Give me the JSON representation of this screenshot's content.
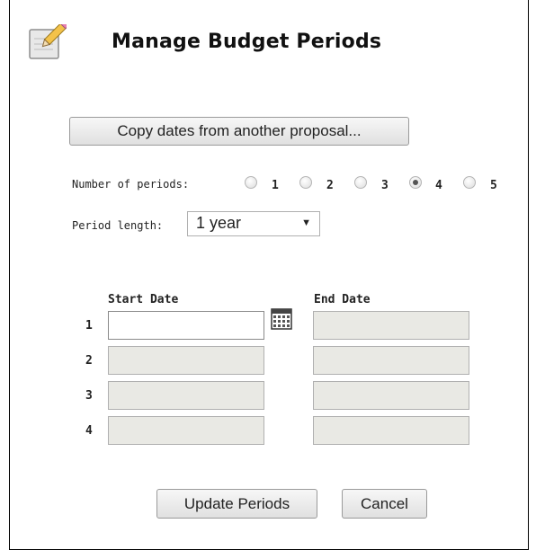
{
  "dialog": {
    "title": "Manage Budget Periods",
    "icon": "edit-note-icon"
  },
  "copy_button": {
    "label": "Copy dates from another proposal..."
  },
  "periods": {
    "label": "Number of periods:",
    "options": [
      "1",
      "2",
      "3",
      "4",
      "5"
    ],
    "selected": "4"
  },
  "period_length": {
    "label": "Period length:",
    "value": "1 year"
  },
  "table": {
    "start_header": "Start Date",
    "end_header": "End Date",
    "rows": [
      {
        "num": "1",
        "start": "",
        "end": ""
      },
      {
        "num": "2",
        "start": "",
        "end": ""
      },
      {
        "num": "3",
        "start": "",
        "end": ""
      },
      {
        "num": "4",
        "start": "",
        "end": ""
      }
    ],
    "calendar_icon": "calendar-icon"
  },
  "actions": {
    "update_label": "Update Periods",
    "cancel_label": "Cancel"
  },
  "colors": {
    "disabled_field": "#e9e9e4",
    "button_border": "#9a9a9a"
  }
}
